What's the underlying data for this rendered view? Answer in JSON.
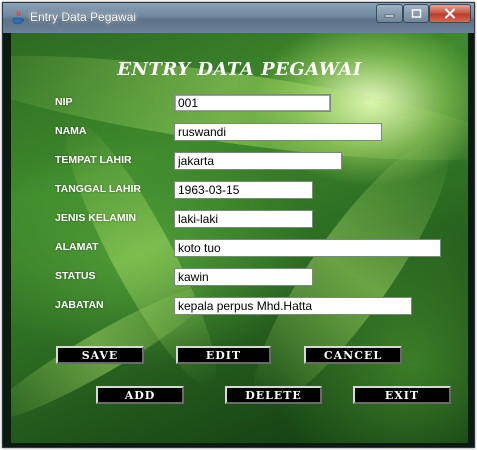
{
  "window": {
    "title": "Entry Data Pegawai"
  },
  "form": {
    "title": "ENTRY DATA PEGAWAI",
    "fields": [
      {
        "label": "NIP",
        "value": "001"
      },
      {
        "label": "NAMA",
        "value": "ruswandi"
      },
      {
        "label": "TEMPAT LAHIR",
        "value": "jakarta"
      },
      {
        "label": "TANGGAL LAHIR",
        "value": "1963-03-15"
      },
      {
        "label": "JENIS KELAMIN",
        "value": "laki-laki"
      },
      {
        "label": "ALAMAT",
        "value": "koto tuo"
      },
      {
        "label": "STATUS",
        "value": "kawin"
      },
      {
        "label": "JABATAN",
        "value": "kepala perpus Mhd.Hatta"
      }
    ]
  },
  "buttons": {
    "save": "SAVE",
    "edit": "EDIT",
    "cancel": "CANCEL",
    "add": "ADD",
    "delete": "DELETE",
    "exit": "EXIT"
  },
  "theme": {
    "titlebar": "#6f879d",
    "close_button": "#c7503a",
    "background": "#2d6a22",
    "button_bg": "#000000"
  },
  "icons": {
    "app": "java-cup-icon",
    "minimize": "minimize-icon",
    "maximize": "maximize-icon",
    "close": "close-icon"
  }
}
